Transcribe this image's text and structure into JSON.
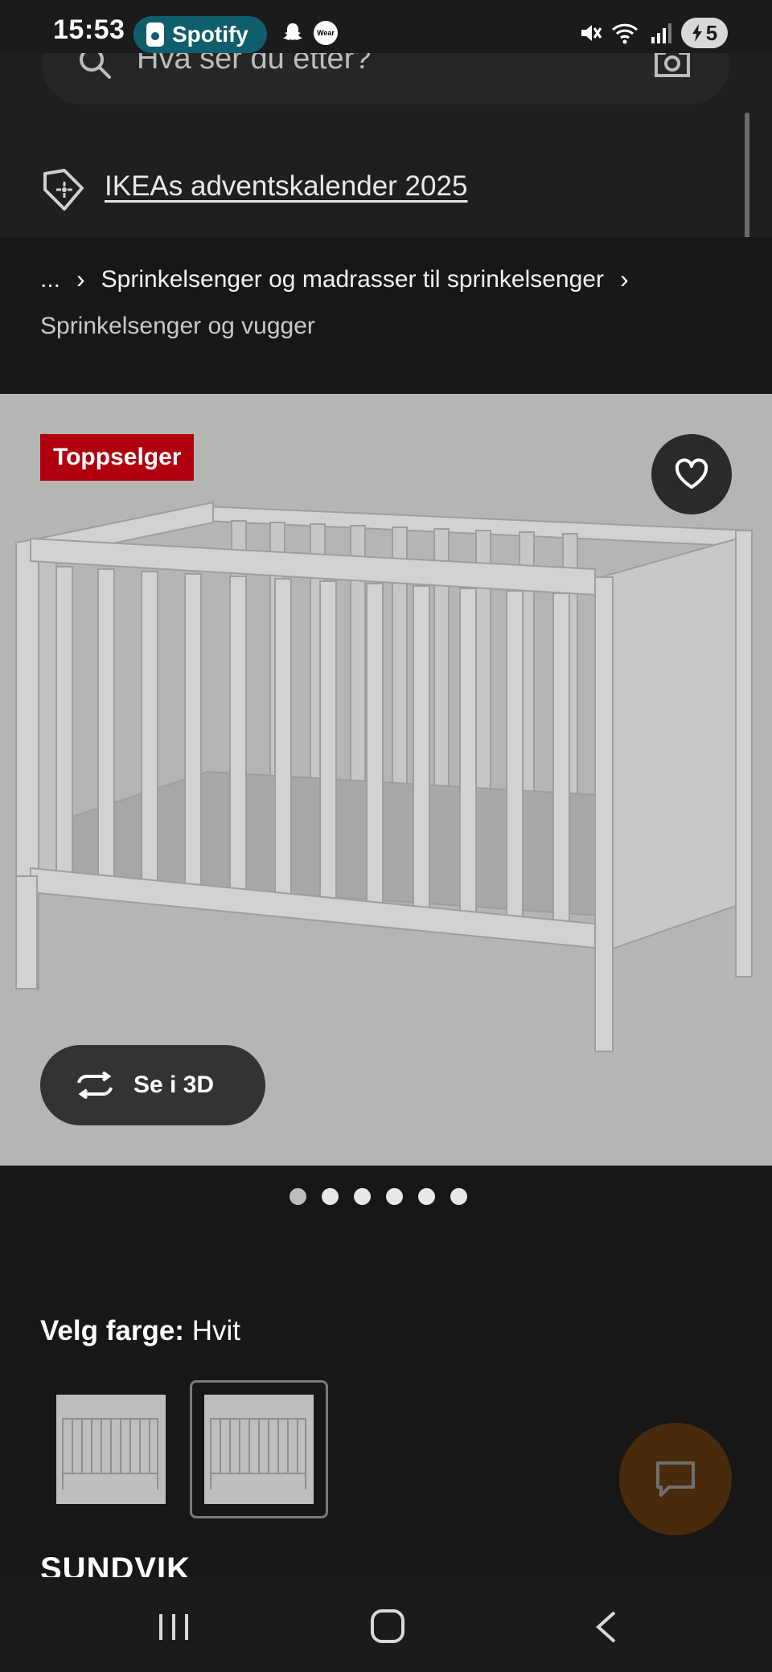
{
  "status_bar": {
    "time": "15:53",
    "spotify_label": "Spotify",
    "wear_label": "Wear",
    "battery": "5",
    "icons": [
      "mute-icon",
      "wifi-icon",
      "signal-icon",
      "battery-icon"
    ]
  },
  "search": {
    "placeholder": "Hva ser du etter?"
  },
  "promo": {
    "link_text": "IKEAs adventskalender 2025"
  },
  "breadcrumb": {
    "ellipsis": "...",
    "parent": "Sprinkelsenger og madrasser til sprinkelsenger",
    "current": "Sprinkelsenger og vugger"
  },
  "product": {
    "badge": "Toppselger",
    "view_3d_label": "Se i 3D",
    "image_count": 6,
    "active_image": 1,
    "color_label": "Velg farge:",
    "color_value": "Hvit",
    "name": "SUNDVIK"
  },
  "colors": {
    "badge_red": "#b0000e",
    "chat_brown": "#4a2a0c",
    "image_bg": "#b5b5b3"
  }
}
